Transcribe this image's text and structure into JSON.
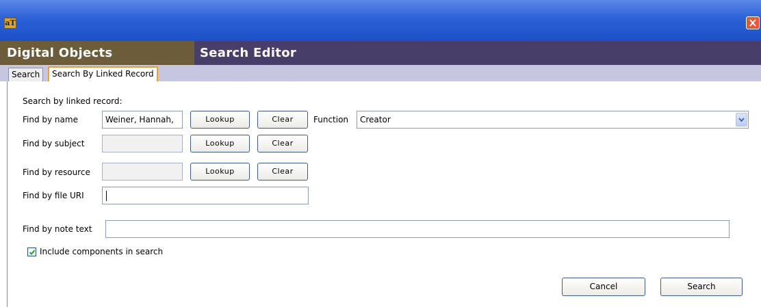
{
  "window": {
    "app_icon_text": "aT",
    "close_icon": "close-icon"
  },
  "header": {
    "module_title": "Digital Objects",
    "editor_title": "Search Editor"
  },
  "tabs": [
    {
      "label": "Search",
      "active": false
    },
    {
      "label": "Search By Linked Record",
      "active": true
    }
  ],
  "form": {
    "section_label": "Search by linked record:",
    "name": {
      "label": "Find by name",
      "value": "Weiner, Hannah,",
      "lookup": "Lookup",
      "clear": "Clear"
    },
    "function": {
      "label": "Function",
      "value": "Creator"
    },
    "subject": {
      "label": "Find by subject",
      "value": "",
      "lookup": "Lookup",
      "clear": "Clear"
    },
    "resource": {
      "label": "Find by resource",
      "value": "",
      "lookup": "Lookup",
      "clear": "Clear"
    },
    "file_uri": {
      "label": "Find by file URI",
      "value": ""
    },
    "note_text": {
      "label": "Find by note text",
      "value": ""
    },
    "include_components": {
      "label": "Include components in search",
      "checked": true
    }
  },
  "actions": {
    "cancel": "Cancel",
    "search": "Search"
  },
  "colors": {
    "accent_tab_border": "#e6a23a",
    "header_left": "#6d5c3a",
    "header_right": "#473f6a",
    "titlebar": "#2b61d6"
  }
}
